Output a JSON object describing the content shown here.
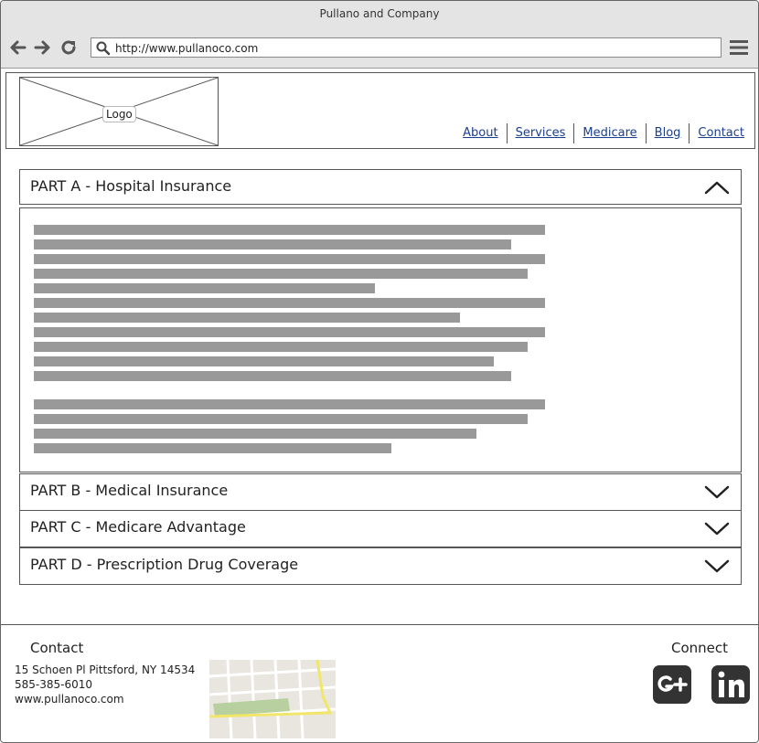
{
  "window": {
    "title": "Pullano and Company"
  },
  "browser": {
    "url": "http://www.pullanoco.com"
  },
  "header": {
    "logo_label": "Logo"
  },
  "nav": [
    {
      "label": "About"
    },
    {
      "label": "Services"
    },
    {
      "label": "Medicare"
    },
    {
      "label": "Blog"
    },
    {
      "label": "Contact"
    }
  ],
  "accordion": [
    {
      "title": "PART A - Hospital Insurance",
      "expanded": true
    },
    {
      "title": "PART B - Medical Insurance",
      "expanded": false
    },
    {
      "title": "PART C - Medicare Advantage",
      "expanded": false
    },
    {
      "title": "PART D - Prescription Drug Coverage",
      "expanded": false
    }
  ],
  "footer": {
    "contact_heading": "Contact",
    "address": "15 Schoen Pl Pittsford, NY 14534",
    "phone": "585-385-6010",
    "website": "www.pullanoco.com",
    "connect_heading": "Connect"
  },
  "icons": [
    "back-arrow-icon",
    "forward-arrow-icon",
    "reload-icon",
    "search-icon",
    "menu-icon",
    "chevron-up-icon",
    "chevron-down-icon",
    "google-plus-icon",
    "linkedin-icon"
  ]
}
